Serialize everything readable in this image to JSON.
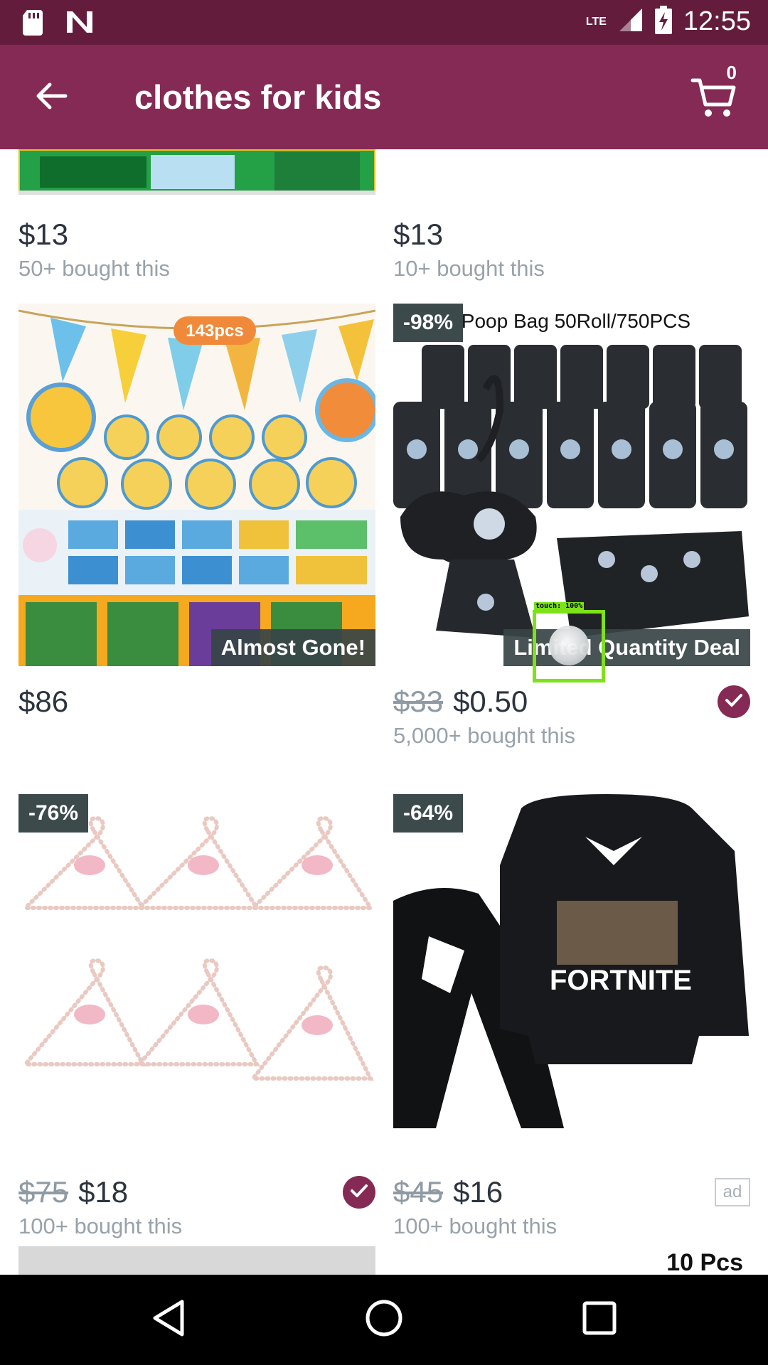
{
  "status_bar": {
    "network": "LTE",
    "time": "12:55"
  },
  "app_bar": {
    "title": "clothes for kids",
    "cart_count": "0"
  },
  "products": [
    {
      "id": "p1",
      "price": "$13",
      "bought": "50+ bought this"
    },
    {
      "id": "p2",
      "price": "$13",
      "bought": "10+ bought this"
    },
    {
      "id": "p3",
      "price": "$86",
      "ribbon": "Almost Gone!",
      "image_text": "143pcs"
    },
    {
      "id": "p4",
      "discount": "-98%",
      "old_price": "$33",
      "price": "$0.50",
      "bought": "5,000+ bought this",
      "ribbon": "Limited Quantity Deal",
      "image_text": "Pet Poop Bag 50Roll/750PCS",
      "verified": true
    },
    {
      "id": "p5",
      "discount": "-76%",
      "old_price": "$75",
      "price": "$18",
      "bought": "100+ bought this",
      "verified": true
    },
    {
      "id": "p6",
      "discount": "-64%",
      "old_price": "$45",
      "price": "$16",
      "bought": "100+ bought this",
      "ad_label": "ad",
      "image_text": "FORTNITE"
    },
    {
      "id": "p8",
      "image_text": "10 Pcs"
    }
  ],
  "touch_indicator": {
    "label": "touch: 100%"
  },
  "colors": {
    "status_bar": "#641c3d",
    "app_bar": "#852a54",
    "accent": "#852a54",
    "badge": "#3d4a4c",
    "touch": "#7de21a"
  },
  "icons": {
    "status_left": [
      "sd-card-icon",
      "n-notification-icon"
    ],
    "status_right": [
      "signal-icon",
      "battery-icon"
    ],
    "app_bar": [
      "back-arrow-icon",
      "cart-icon"
    ],
    "nav": [
      "nav-back-icon",
      "nav-home-icon",
      "nav-recents-icon"
    ]
  }
}
